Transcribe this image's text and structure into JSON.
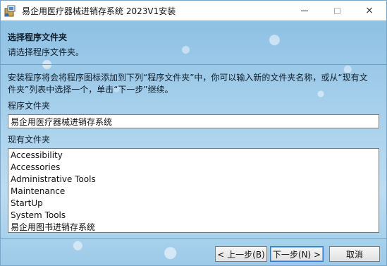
{
  "window": {
    "title": "易企用医疗器械进销存系统 2023V1安装",
    "icon": "installer-icon"
  },
  "titlebar_buttons": {
    "minimize": "minimize-icon",
    "maximize": "maximize-icon",
    "close": "×"
  },
  "header": {
    "title": "选择程序文件夹",
    "subtitle": "请选择程序文件夹。"
  },
  "body": {
    "description": "安装程序将会将程序图标添加到下列“程序文件夹”中，你可以输入新的文件夹名称，或从“现有文件夹”列表中选择一个，单击“下一步”继续。",
    "program_folder_label": "程序文件夹",
    "program_folder_value": "易企用医疗器械进销存系统",
    "existing_folders_label": "现有文件夹",
    "existing_folders": [
      "Accessibility",
      "Accessories",
      "Administrative Tools",
      "Maintenance",
      "StartUp",
      "System Tools",
      "易企用图书进销存系统"
    ]
  },
  "buttons": {
    "back": "< 上一步(B)",
    "next": "下一步(N) >",
    "cancel": "取消"
  },
  "colors": {
    "background": "#a9d1ec",
    "separator": "#6f9fc2",
    "default_button_border": "#2a7ad1"
  }
}
